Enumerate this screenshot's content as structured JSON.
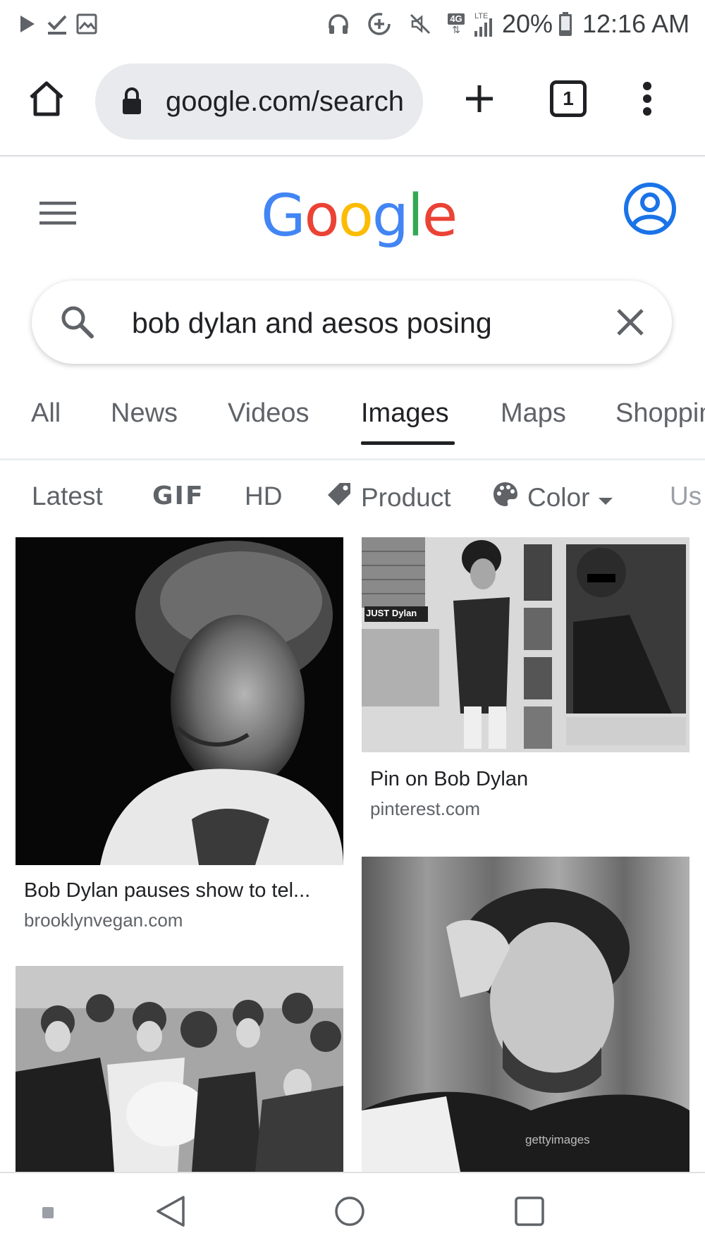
{
  "status_bar": {
    "icons": [
      "play-icon",
      "download-done-icon",
      "image-icon",
      "headphones-icon",
      "data-saver-icon",
      "mute-icon",
      "4g-icon",
      "lte-signal-icon",
      "battery-icon"
    ],
    "network_label": "4G",
    "lte_label": "LTE",
    "battery": "20%",
    "time": "12:16 AM"
  },
  "browser": {
    "url": "google.com/search",
    "tab_count": "1"
  },
  "google": {
    "logo_letters": [
      "G",
      "o",
      "o",
      "g",
      "l",
      "e"
    ],
    "logo_colors": [
      "#4285F4",
      "#EA4335",
      "#FBBC05",
      "#4285F4",
      "#34A853",
      "#EA4335"
    ]
  },
  "search": {
    "query": "bob dylan and aesos posing"
  },
  "tabs": [
    "All",
    "News",
    "Videos",
    "Images",
    "Maps",
    "Shopping"
  ],
  "active_tab": "Images",
  "chips": {
    "latest": "Latest",
    "gif": "GIF",
    "hd": "HD",
    "product": "Product",
    "color": "Color",
    "usage": "Us"
  },
  "results": [
    {
      "title": "Bob Dylan pauses show to tel...",
      "source": "brooklynvegan.com"
    },
    {
      "title": "Pin on Bob Dylan",
      "source": "pinterest.com"
    },
    {
      "title": "",
      "source": ""
    },
    {
      "title": "",
      "source": ""
    }
  ],
  "image_labels": {
    "magazine_header": "JUST Dylan",
    "watermark": "gettyimages"
  },
  "colors": {
    "accent_blue": "#1a73e8",
    "text_primary": "#202124",
    "text_secondary": "#5f6368"
  }
}
